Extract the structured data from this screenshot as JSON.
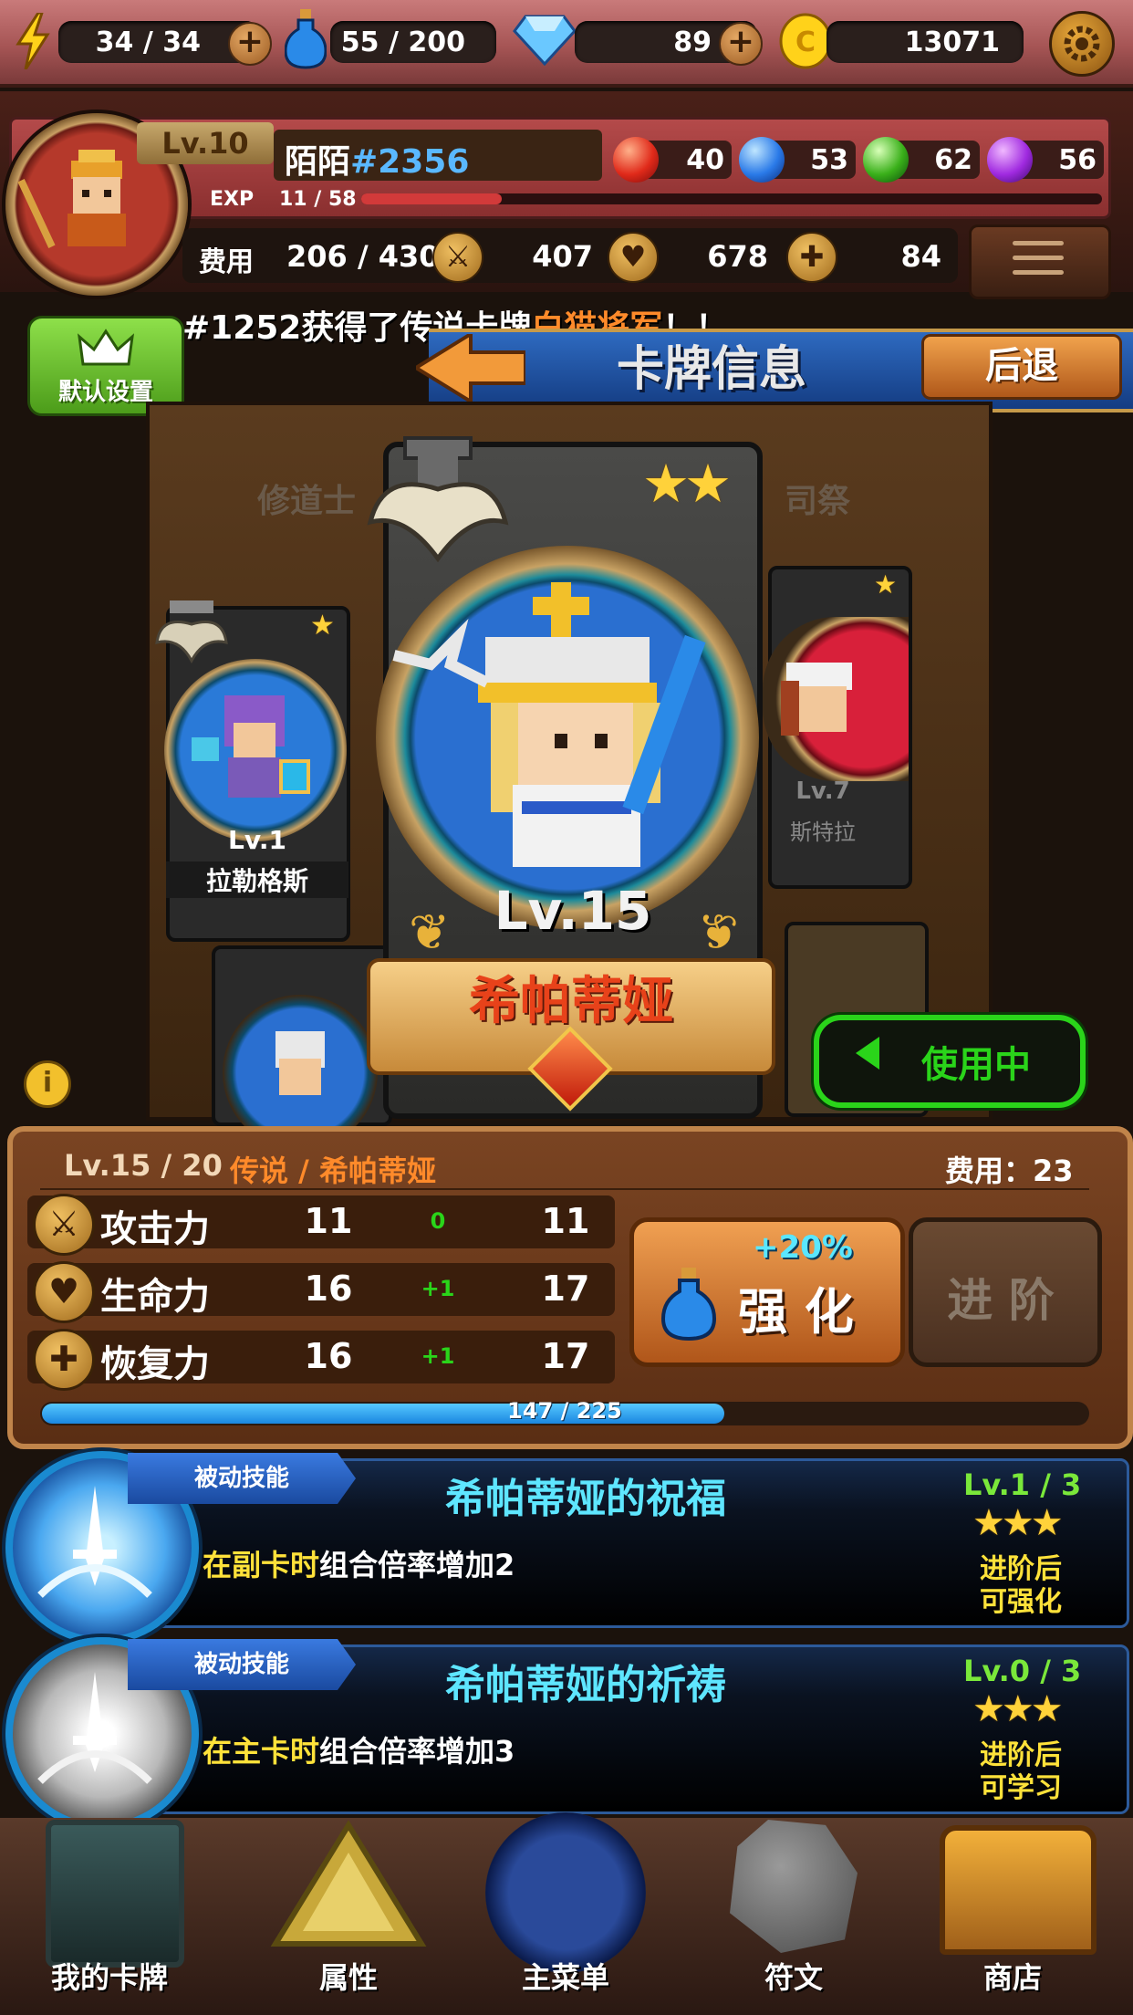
{
  "resources": {
    "energy": "34 / 34",
    "potion": "55 / 200",
    "gems": "89",
    "coins": "13071"
  },
  "player": {
    "level": "Lv.10",
    "name": "陌陌",
    "tag": "#2356",
    "exp_label": "EXP",
    "exp": "11 / 58",
    "exp_progress": 0.19,
    "orbs": {
      "fire": "40",
      "water": "53",
      "nature": "62",
      "dark": "56"
    },
    "cost_label": "费用",
    "cost": "206 / 430",
    "attack": "407",
    "hp": "678",
    "recovery": "84"
  },
  "ticker": {
    "prefix": "#1252获得了传说卡牌",
    "highlight": "白猫将军",
    "suffix": "！！"
  },
  "default_settings_label": "默认设置",
  "header": {
    "title": "卡牌信息",
    "back_label": "后退"
  },
  "carousel": {
    "category_left": "修道士",
    "category_right": "司祭",
    "left_card": {
      "level": "Lv.1",
      "name": "拉勒格斯",
      "stars": "★"
    },
    "right_card": {
      "level": "Lv.7",
      "name": "斯特拉",
      "stars": "★"
    },
    "main_card": {
      "level": "Lv.15",
      "name": "希帕蒂娅",
      "stars": "★★"
    },
    "in_use_label": "使用中"
  },
  "stats_panel": {
    "level_info": "Lv.15 / 20",
    "rarity_name": "传说 / 希帕蒂娅",
    "cost_label": "费用：23",
    "rows": [
      {
        "label": "攻击力",
        "base": "11",
        "delta": "0",
        "total": "11"
      },
      {
        "label": "生命力",
        "base": "16",
        "delta": "+1",
        "total": "17"
      },
      {
        "label": "恢复力",
        "base": "16",
        "delta": "+1",
        "total": "17"
      }
    ],
    "enhance_bonus": "+20%",
    "enhance_label": "强 化",
    "advance_label": "进 阶",
    "xp": "147 / 225",
    "xp_progress": 0.653
  },
  "skills": [
    {
      "tag": "被动技能",
      "title": "希帕蒂娅的祝福",
      "level": "Lv.1 / 3",
      "desc_highlight": "在副卡时",
      "desc_rest": "组合倍率增加2",
      "stars": "★★★",
      "note_line1": "进阶后",
      "note_line2": "可强化"
    },
    {
      "tag": "被动技能",
      "title": "希帕蒂娅的祈祷",
      "level": "Lv.0 / 3",
      "desc_highlight": "在主卡时",
      "desc_rest": "组合倍率增加3",
      "stars": "★★★",
      "note_line1": "进阶后",
      "note_line2": "可学习"
    }
  ],
  "nav": {
    "my_cards": "我的卡牌",
    "attribute": "属性",
    "main_menu": "主菜单",
    "rune": "符文",
    "shop": "商店"
  },
  "colors": {
    "accent_orange": "#ff8a2a",
    "highlight_yellow": "#ffe23a",
    "in_use_green": "#2ad41a",
    "skill_title_cyan": "#5ee6ff"
  }
}
